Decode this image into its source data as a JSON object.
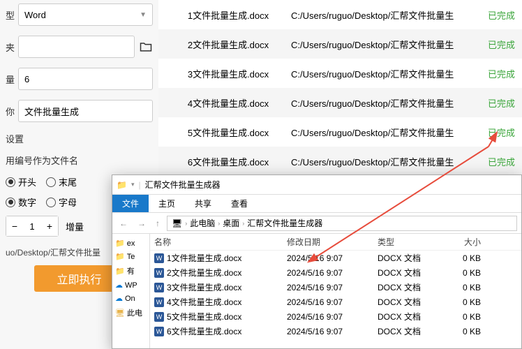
{
  "left": {
    "type_label": "型",
    "type_value": "Word",
    "folder_label": "夹",
    "count_label": "量",
    "count_value": "6",
    "name_label": "你",
    "name_value": "文件批量生成",
    "settings_label": "设置",
    "filename_option": "用编号作为文件名",
    "pos_head": "开头",
    "pos_tail": "末尾",
    "type_number": "数字",
    "type_letter": "字母",
    "step_start": "1",
    "step_label": "增量",
    "path_text": "uo/Desktop/汇帮文件批量",
    "execute": "立即执行"
  },
  "results": [
    {
      "name": "1文件批量生成.docx",
      "path": "C:/Users/ruguo/Desktop/汇帮文件批量生",
      "status": "已完成"
    },
    {
      "name": "2文件批量生成.docx",
      "path": "C:/Users/ruguo/Desktop/汇帮文件批量生",
      "status": "已完成"
    },
    {
      "name": "3文件批量生成.docx",
      "path": "C:/Users/ruguo/Desktop/汇帮文件批量生",
      "status": "已完成"
    },
    {
      "name": "4文件批量生成.docx",
      "path": "C:/Users/ruguo/Desktop/汇帮文件批量生",
      "status": "已完成"
    },
    {
      "name": "5文件批量生成.docx",
      "path": "C:/Users/ruguo/Desktop/汇帮文件批量生",
      "status": "已完成"
    },
    {
      "name": "6文件批量生成.docx",
      "path": "C:/Users/ruguo/Desktop/汇帮文件批量生",
      "status": "已完成"
    }
  ],
  "explorer": {
    "title": "汇帮文件批量生成器",
    "menu": {
      "file": "文件",
      "home": "主页",
      "share": "共享",
      "view": "查看"
    },
    "crumbs": [
      "此电脑",
      "桌面",
      "汇帮文件批量生成器"
    ],
    "sidebar": [
      "ex",
      "Te",
      "有",
      "WP",
      "On",
      "此电"
    ],
    "headers": {
      "name": "名称",
      "date": "修改日期",
      "type": "类型",
      "size": "大小"
    },
    "files": [
      {
        "name": "1文件批量生成.docx",
        "date": "2024/5/16 9:07",
        "type": "DOCX 文档",
        "size": "0 KB"
      },
      {
        "name": "2文件批量生成.docx",
        "date": "2024/5/16 9:07",
        "type": "DOCX 文档",
        "size": "0 KB"
      },
      {
        "name": "3文件批量生成.docx",
        "date": "2024/5/16 9:07",
        "type": "DOCX 文档",
        "size": "0 KB"
      },
      {
        "name": "4文件批量生成.docx",
        "date": "2024/5/16 9:07",
        "type": "DOCX 文档",
        "size": "0 KB"
      },
      {
        "name": "5文件批量生成.docx",
        "date": "2024/5/16 9:07",
        "type": "DOCX 文档",
        "size": "0 KB"
      },
      {
        "name": "6文件批量生成.docx",
        "date": "2024/5/16 9:07",
        "type": "DOCX 文档",
        "size": "0 KB"
      }
    ]
  }
}
